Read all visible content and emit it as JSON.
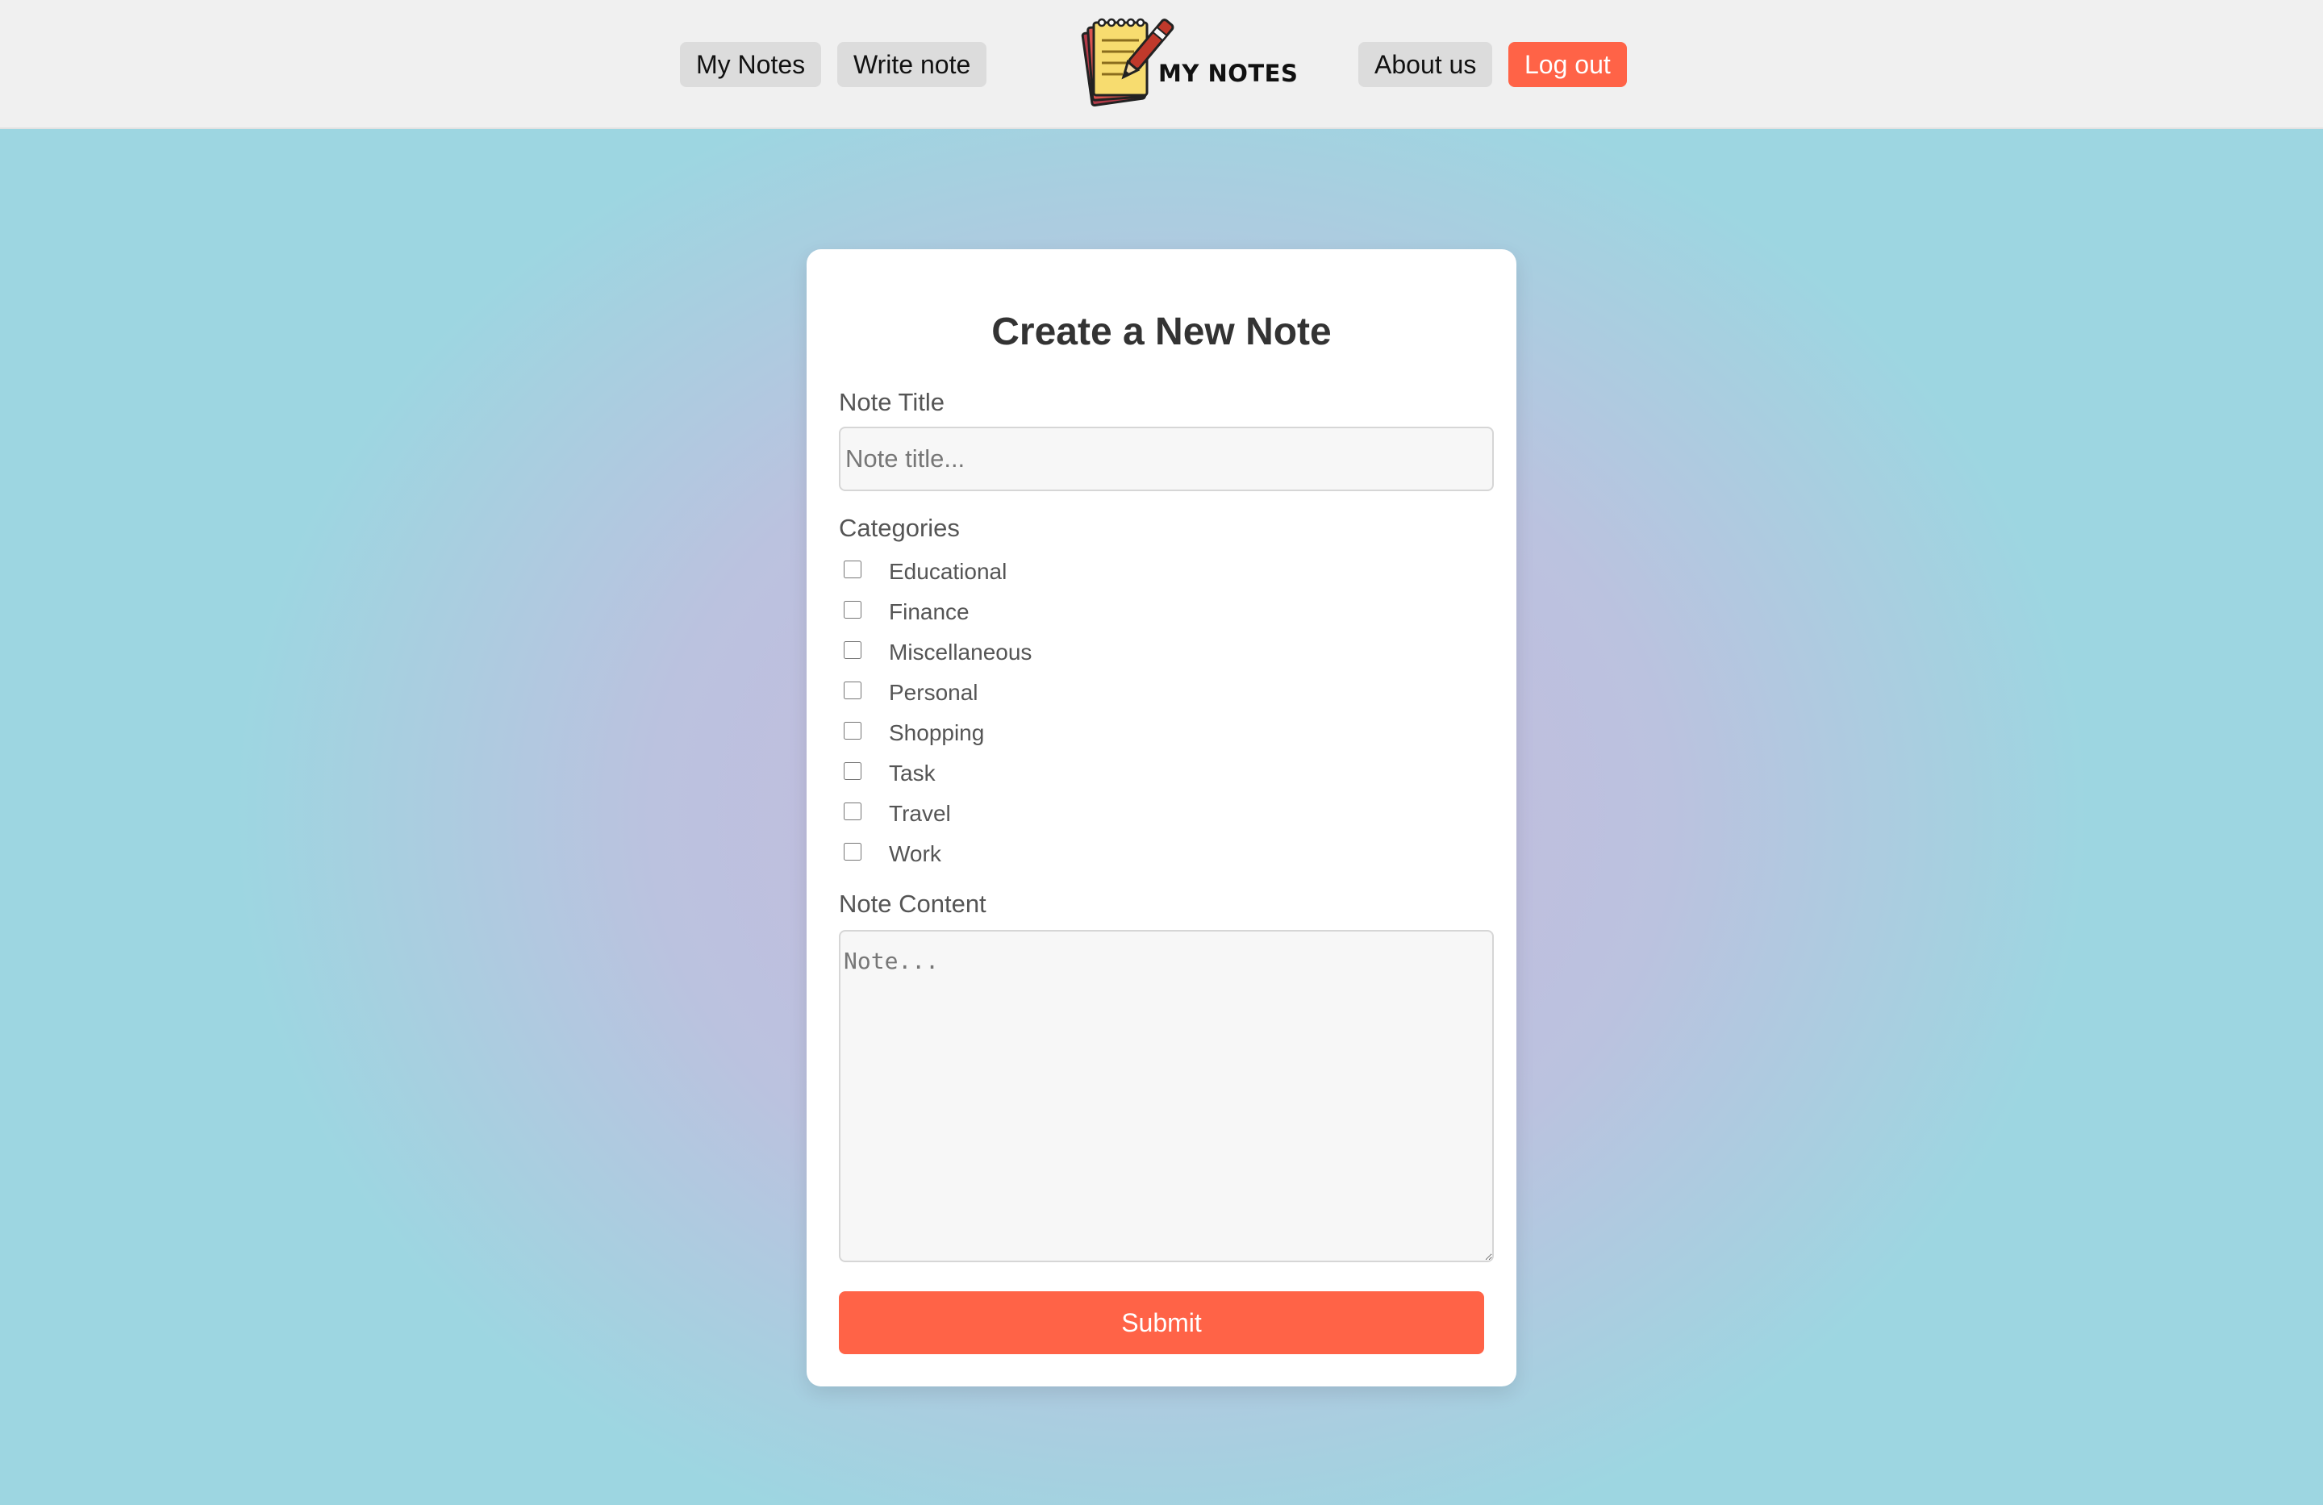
{
  "nav": {
    "my_notes": "My Notes",
    "write_note": "Write note",
    "about_us": "About us",
    "log_out": "Log out"
  },
  "logo": {
    "text": "MY NOTES",
    "icon": "notepad-pen-icon"
  },
  "form": {
    "title": "Create a New Note",
    "note_title_label": "Note Title",
    "note_title_placeholder": "Note title...",
    "note_title_value": "",
    "categories_label": "Categories",
    "categories": [
      {
        "label": "Educational",
        "checked": false
      },
      {
        "label": "Finance",
        "checked": false
      },
      {
        "label": "Miscellaneous",
        "checked": false
      },
      {
        "label": "Personal",
        "checked": false
      },
      {
        "label": "Shopping",
        "checked": false
      },
      {
        "label": "Task",
        "checked": false
      },
      {
        "label": "Travel",
        "checked": false
      },
      {
        "label": "Work",
        "checked": false
      }
    ],
    "note_content_label": "Note Content",
    "note_content_placeholder": "Note...",
    "note_content_value": "",
    "submit_label": "Submit"
  },
  "colors": {
    "accent": "#ff6347",
    "topbar": "#f0f0f0",
    "nav_button": "#dcdcdc",
    "background_center": "#c7b8dd",
    "background_edge": "#9dd6e1"
  }
}
